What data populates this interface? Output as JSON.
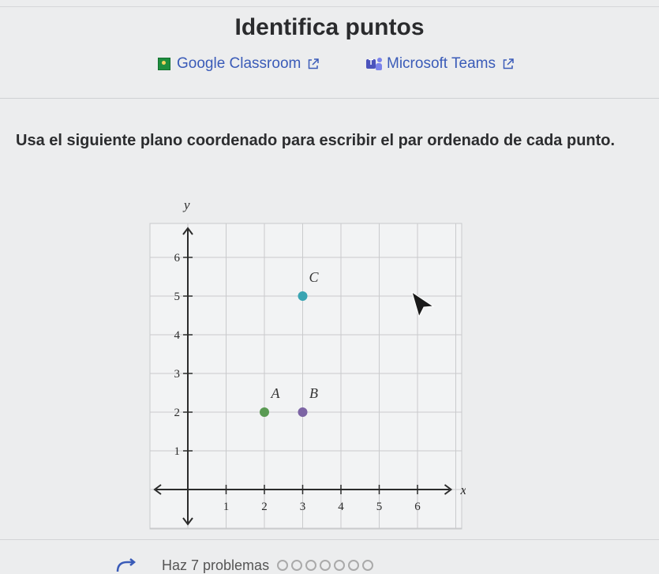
{
  "page": {
    "title": "Identifica puntos",
    "share": {
      "google_classroom": "Google Classroom",
      "microsoft_teams": "Microsoft Teams"
    },
    "instructions": "Usa el siguiente plano coordenado para escribir el par ordenado de cada punto.",
    "footer": {
      "text": "Haz 7 problemas",
      "progress_total": 7
    }
  },
  "graph": {
    "x_axis_label": "x",
    "y_axis_label": "y",
    "x_ticks": [
      1,
      2,
      3,
      4,
      5,
      6
    ],
    "y_ticks": [
      1,
      2,
      3,
      4,
      5,
      6
    ],
    "x_range": [
      -1,
      7
    ],
    "y_range": [
      -0.8,
      6.9
    ],
    "points": [
      {
        "label": "A",
        "x": 2,
        "y": 2,
        "color": "#5a9a53"
      },
      {
        "label": "B",
        "x": 3,
        "y": 2,
        "color": "#7c64a4"
      },
      {
        "label": "C",
        "x": 3,
        "y": 5,
        "color": "#3aa5b3"
      }
    ],
    "grid": true
  },
  "colors": {
    "link": "#3a5bb8",
    "grid": "#c9cacc",
    "axis": "#2b2b2b"
  }
}
